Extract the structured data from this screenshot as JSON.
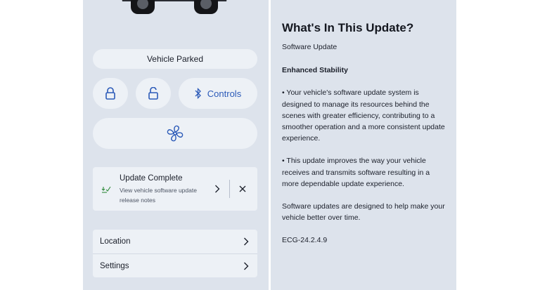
{
  "left_panel": {
    "status_label": "Vehicle Parked",
    "controls_label": "Controls",
    "update_card": {
      "title": "Update Complete",
      "subtitle": "View vehicle software update release notes"
    },
    "menu": [
      {
        "label": "Location"
      },
      {
        "label": "Settings"
      }
    ]
  },
  "right_panel": {
    "title": "What's In This Update?",
    "subtitle": "Software Update",
    "heading": "Enhanced Stability",
    "bullet_1": "• Your vehicle's software update system is designed to manage its resources behind the scenes with greater efficiency, contributing to a smoother operation and a more consistent update experience.",
    "bullet_2": "• This update improves the way your vehicle receives and transmits software resulting in a more dependable update experience.",
    "closing": "Software updates are designed to help make your vehicle better over time.",
    "version": "ECG-24.2.4.9"
  },
  "colors": {
    "panel_bg": "#dde3ec",
    "card_bg": "#edf1f6",
    "accent_blue": "#2b5ab8",
    "check_green": "#2f8a3a"
  },
  "icons": {
    "lock": "lock-icon",
    "unlock": "unlock-icon",
    "controls": "bluetooth-icon",
    "fan": "fan-icon",
    "update": "download-check-icon",
    "chevron": "chevron-right-icon",
    "close": "close-icon"
  }
}
